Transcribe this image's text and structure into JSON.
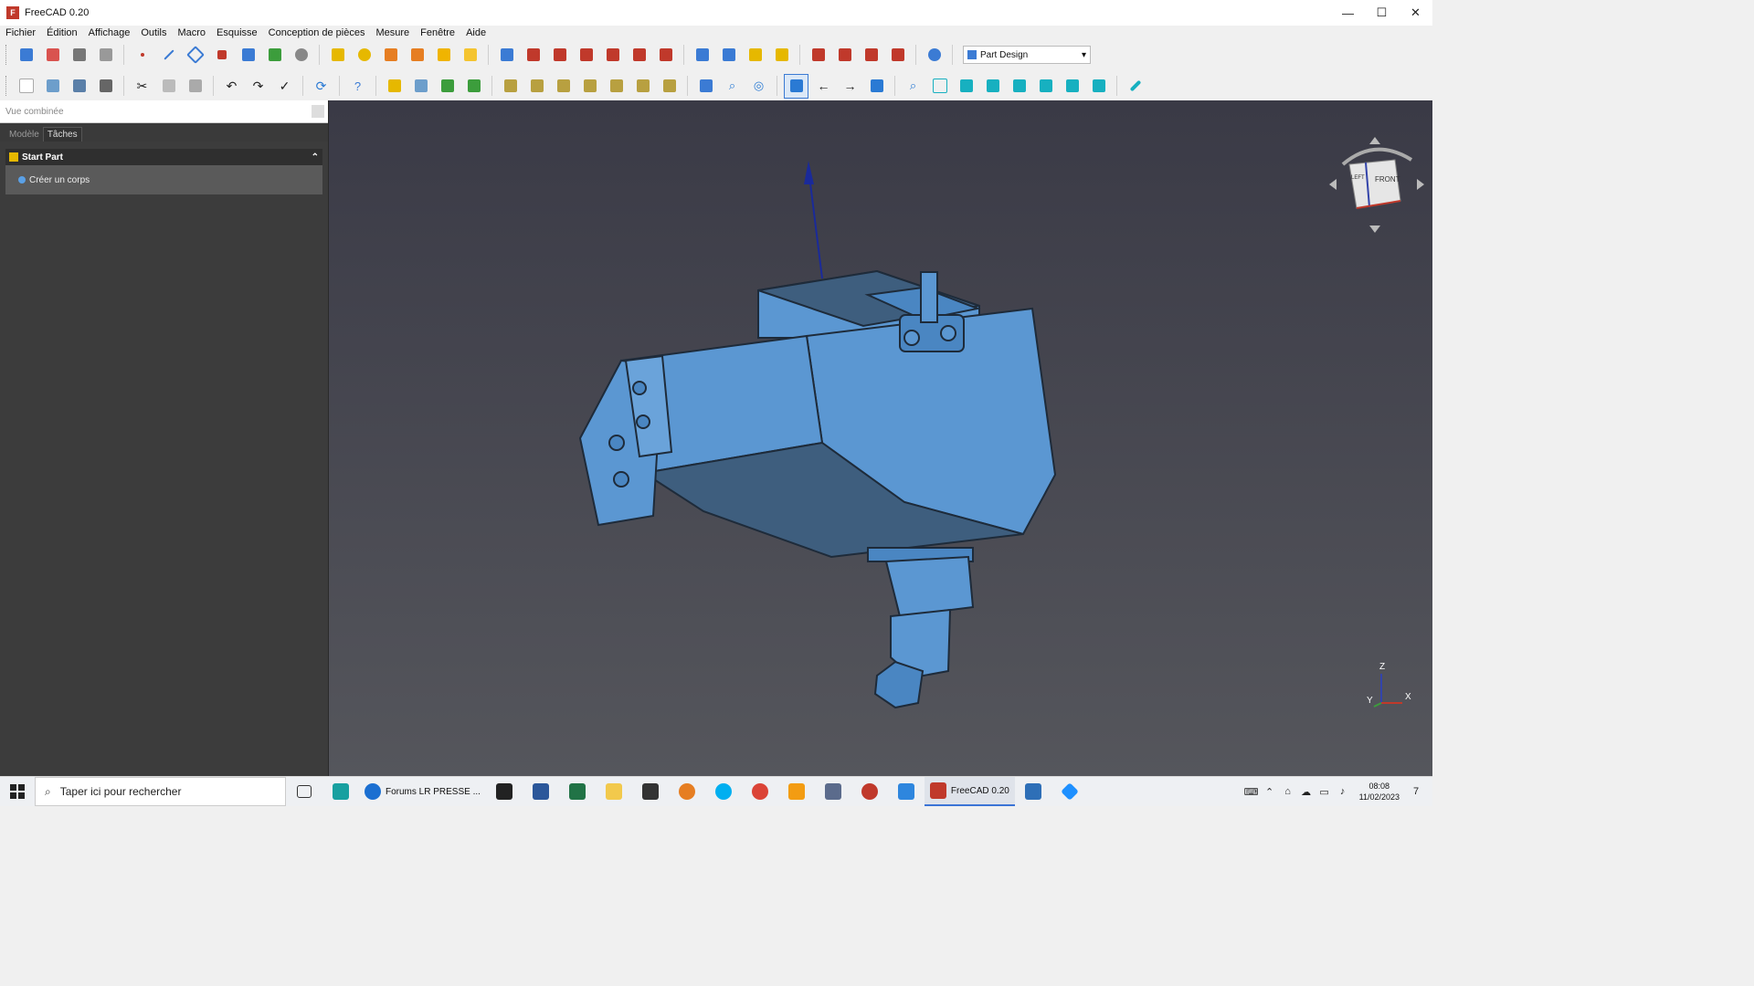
{
  "window": {
    "title": "FreeCAD 0.20",
    "logo_text": "F",
    "controls": {
      "minimize": "—",
      "maximize": "☐",
      "close": "✕"
    }
  },
  "menubar": {
    "items": [
      "Fichier",
      "Édition",
      "Affichage",
      "Outils",
      "Macro",
      "Esquisse",
      "Conception de pièces",
      "Mesure",
      "Fenêtre",
      "Aide"
    ]
  },
  "toolbar": {
    "workbench_value": "Part Design",
    "row1_icons": [
      "body-icon",
      "sketch-icon",
      "import-icon",
      "clone-icon",
      "datum-point-icon",
      "datum-line-icon",
      "datum-plane-icon",
      "local-cs-icon",
      "shape-binder-icon",
      "subshape-binder-icon",
      "sub-shape-icon",
      "pad-icon",
      "revolution-icon",
      "additive-loft-icon",
      "additive-pipe-icon",
      "additive-helix-icon",
      "additive-primitive-icon",
      "pocket-icon",
      "hole-icon",
      "groove-icon",
      "subtractive-loft-icon",
      "subtractive-pipe-icon",
      "subtractive-helix-icon",
      "subtractive-primitive-icon",
      "mirrored-icon",
      "linear-pattern-icon",
      "polar-pattern-icon",
      "multi-transform-icon",
      "fillet-icon",
      "chamfer-icon",
      "draft-icon",
      "thickness-icon",
      "boolean-icon"
    ],
    "row2_icons": [
      "new-icon",
      "open-icon",
      "save-icon",
      "print-icon",
      "cut-icon",
      "copy-icon",
      "paste-icon",
      "undo-icon",
      "redo-icon",
      "refresh-check-icon",
      "recompute-icon",
      "whats-this-icon",
      "part-icon",
      "group-icon",
      "link-icon",
      "link-actions-icon",
      "view-fit-all-icon",
      "view-fit-selection-icon",
      "draw-style-icon",
      "bounding-box-icon",
      "std-view-icon",
      "box-selection-icon",
      "zoom-box-icon",
      "nav-back-icon",
      "nav-forward-icon",
      "sync-view-icon",
      "view-isometric-icon",
      "view-front-icon",
      "view-top-icon",
      "view-right-icon",
      "view-rear-icon",
      "view-bottom-icon",
      "view-left-icon",
      "measure-icon"
    ]
  },
  "left_panel": {
    "header": "Vue combinée",
    "tabs": [
      "Modèle",
      "Tâches"
    ],
    "active_tab": "Tâches",
    "task_title": "Start Part",
    "task_action": "Créer un corps"
  },
  "viewport": {
    "navcube_face": "FRONT",
    "navcube_side": "LEFT",
    "axis_labels": {
      "z": "Z",
      "y": "Y",
      "x": "X"
    }
  },
  "taskbar": {
    "search_placeholder": "Taper ici pour rechercher",
    "apps": [
      {
        "label": "Forums LR PRESSE ...",
        "color": "#1b6fd1"
      },
      {
        "label": "FreeCAD 0.20",
        "color": "#c0392b"
      }
    ],
    "pinned_icons": [
      "task-view-icon",
      "pinwheel-icon",
      "7zip-icon",
      "word-icon",
      "excel-icon",
      "explorer-icon",
      "inkscape-icon",
      "orange-app-icon",
      "skype-icon",
      "chrome-icon",
      "f-app-icon",
      "calculator-icon",
      "raspberry-icon",
      "mail-icon",
      "monitor-icon",
      "blue-app-icon"
    ],
    "clock_time": "08:08",
    "clock_date": "11/02/2023",
    "notification_count": "7"
  },
  "colors": {
    "part_blue": "#4f8fd0",
    "viewport_top": "#3a3a46",
    "viewport_bottom": "#55565c"
  }
}
